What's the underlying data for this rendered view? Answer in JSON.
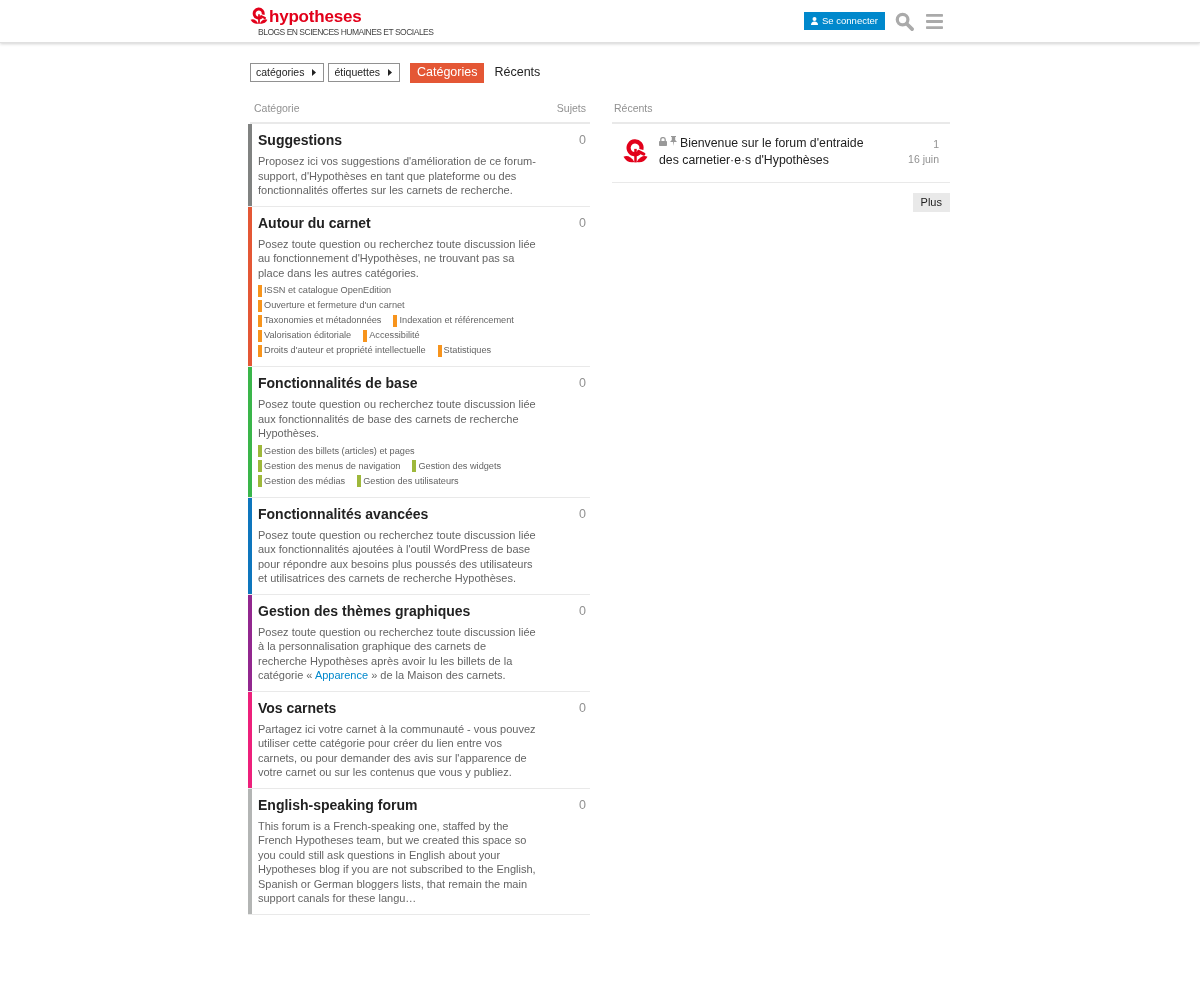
{
  "header": {
    "logo": {
      "wordmark": "hypotheses",
      "tagline": "BLOGS EN SCIENCES HUMAINES ET SOCIALES"
    },
    "login_button": "Se connecter"
  },
  "nav": {
    "dropdowns": [
      "catégories",
      "étiquettes"
    ],
    "tabs": [
      {
        "label": "Catégories",
        "selected": true
      },
      {
        "label": "Récents",
        "selected": false
      }
    ]
  },
  "categories": {
    "columns": [
      "Catégorie",
      "Sujets"
    ],
    "rows": [
      {
        "name": "Suggestions",
        "color": "#808281",
        "description": [
          {
            "kind": "text",
            "text": "Proposez ici vos suggestions d'amélioration de ce forum-support, d'Hypothèses en tant que plateforme ou des fonctionnalités offertes sur les carnets de recherche."
          }
        ],
        "topics": "0"
      },
      {
        "name": "Autour du carnet",
        "color": "#e45735",
        "description": [
          {
            "kind": "text",
            "text": "Posez toute question ou recherchez toute discussion liée au fonctionnement d'Hypothèses, ne trouvant pas sa place dans les autres catégories."
          }
        ],
        "topics": "0",
        "subcategories": [
          {
            "name": "ISSN et catalogue OpenEdition",
            "color": "#f7941d"
          },
          {
            "name": "Ouverture et fermeture d'un carnet",
            "color": "#f7941d"
          },
          {
            "name": "Taxonomies et métadonnées",
            "color": "#f7941d"
          },
          {
            "name": "Indexation et référencement",
            "color": "#f7941d"
          },
          {
            "name": "Valorisation éditoriale",
            "color": "#f7941d"
          },
          {
            "name": "Accessibilité",
            "color": "#f7941d"
          },
          {
            "name": "Droits d'auteur et propriété intellectuelle",
            "color": "#f7941d"
          },
          {
            "name": "Statistiques",
            "color": "#f7941d"
          }
        ]
      },
      {
        "name": "Fonctionnalités de base",
        "color": "#3ab54a",
        "description": [
          {
            "kind": "text",
            "text": "Posez toute question ou recherchez toute discussion liée aux fonctionnalités de base des carnets de recherche Hypothèses."
          }
        ],
        "topics": "0",
        "subcategories": [
          {
            "name": "Gestion des billets (articles) et pages",
            "color": "#9eb83b"
          },
          {
            "name": "Gestion des menus de navigation",
            "color": "#9eb83b"
          },
          {
            "name": "Gestion des widgets",
            "color": "#9eb83b"
          },
          {
            "name": "Gestion des médias",
            "color": "#9eb83b"
          },
          {
            "name": "Gestion des utilisateurs",
            "color": "#9eb83b"
          }
        ]
      },
      {
        "name": "Fonctionnalités avancées",
        "color": "#0e76bd",
        "description": [
          {
            "kind": "text",
            "text": "Posez toute question ou recherchez toute discussion liée aux fonctionnalités ajoutées à l'outil WordPress de base pour répondre aux besoins plus poussés des utilisateurs et utilisatrices des carnets de recherche Hypothèses."
          }
        ],
        "topics": "0"
      },
      {
        "name": "Gestion des thèmes graphiques",
        "color": "#92278f",
        "description": [
          {
            "kind": "text",
            "text": "Posez toute question ou recherchez toute discussion liée à la personnalisation graphique des carnets de recherche Hypothèses après avoir lu les billets de la catégorie « "
          },
          {
            "kind": "link",
            "text": "Apparence"
          },
          {
            "kind": "text",
            "text": " » de la Maison des carnets."
          }
        ],
        "topics": "0"
      },
      {
        "name": "Vos carnets",
        "color": "#ed207b",
        "description": [
          {
            "kind": "text",
            "text": "Partagez ici votre carnet à la communauté - vous pouvez utiliser cette catégorie pour créer du lien entre vos carnets, ou pour demander des avis sur l'apparence de votre carnet ou sur les contenus que vous y publiez."
          }
        ],
        "topics": "0"
      },
      {
        "name": "English-speaking forum",
        "color": "#b3b5b4",
        "description": [
          {
            "kind": "text",
            "text": "This forum is a French-speaking one, staffed by the French Hypotheses team, but we created this space so you could still ask questions in English about your Hypotheses blog if you are not subscribed to the English, Spanish or German bloggers lists, that remain the main support canals for these langu…"
          }
        ],
        "topics": "0"
      }
    ]
  },
  "recent": {
    "heading": "Récents",
    "topics": [
      {
        "title": "Bienvenue sur le forum d'entraide des carnetier·e·s d'Hypothèses",
        "locked": true,
        "pinned": true,
        "posts": "1",
        "date": "16 juin"
      }
    ],
    "more_button": "Plus"
  }
}
